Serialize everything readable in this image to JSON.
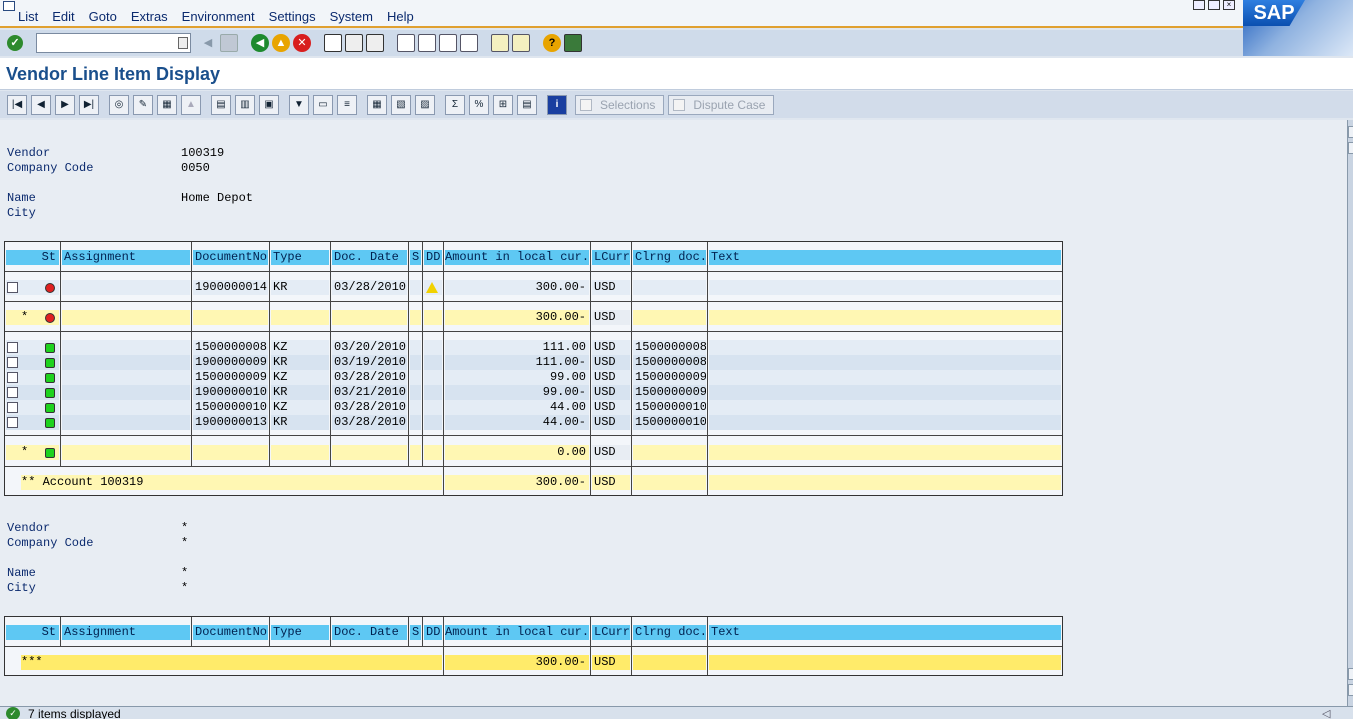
{
  "menu": [
    "List",
    "Edit",
    "Goto",
    "Extras",
    "Environment",
    "Settings",
    "System",
    "Help"
  ],
  "brand": "SAP",
  "title": "Vendor Line Item Display",
  "app_toolbar": {
    "selections_label": "Selections",
    "dispute_label": "Dispute Case"
  },
  "block1": {
    "vendor_label": "Vendor",
    "vendor_value": "100319",
    "company_label": "Company Code",
    "company_value": "0050",
    "name_label": "Name",
    "name_value": "Home Depot",
    "city_label": "City",
    "city_value": ""
  },
  "columns": {
    "st": "St",
    "assignment": "Assignment",
    "docno": "DocumentNo",
    "type": "Type",
    "docdate": "Doc. Date",
    "s": "S",
    "dd": "DD",
    "amount": "Amount in local cur.",
    "lcurr": "LCurr",
    "clrng": "Clrng doc.",
    "text": "Text"
  },
  "group1": {
    "items": [
      {
        "docno": "1900000014",
        "type": "KR",
        "date": "03/28/2010",
        "amount": "300.00-",
        "curr": "USD",
        "clrng": ""
      }
    ],
    "subtotal_marker": "*",
    "subtotal": "300.00-",
    "subtotal_curr": "USD"
  },
  "group2": {
    "items": [
      {
        "docno": "1500000008",
        "type": "KZ",
        "date": "03/20/2010",
        "amount": "111.00",
        "curr": "USD",
        "clrng": "1500000008"
      },
      {
        "docno": "1900000009",
        "type": "KR",
        "date": "03/19/2010",
        "amount": "111.00-",
        "curr": "USD",
        "clrng": "1500000008"
      },
      {
        "docno": "1500000009",
        "type": "KZ",
        "date": "03/28/2010",
        "amount": "99.00",
        "curr": "USD",
        "clrng": "1500000009"
      },
      {
        "docno": "1900000010",
        "type": "KR",
        "date": "03/21/2010",
        "amount": "99.00-",
        "curr": "USD",
        "clrng": "1500000009"
      },
      {
        "docno": "1500000010",
        "type": "KZ",
        "date": "03/28/2010",
        "amount": "44.00",
        "curr": "USD",
        "clrng": "1500000010"
      },
      {
        "docno": "1900000013",
        "type": "KR",
        "date": "03/28/2010",
        "amount": "44.00-",
        "curr": "USD",
        "clrng": "1500000010"
      }
    ],
    "subtotal_marker": "*",
    "subtotal": "0.00",
    "subtotal_curr": "USD"
  },
  "account_total": {
    "label": "** Account 100319",
    "amount": "300.00-",
    "curr": "USD"
  },
  "block2": {
    "vendor_label": "Vendor",
    "vendor_value": "*",
    "company_label": "Company Code",
    "company_value": "*",
    "name_label": "Name",
    "name_value": "*",
    "city_label": "City",
    "city_value": "*"
  },
  "grand_total": {
    "label": "***",
    "amount": "300.00-",
    "curr": "USD"
  },
  "status": {
    "message": "7 items displayed"
  },
  "colors": {
    "header_blue": "#5ec8f3",
    "subtotal_yellow": "#fff7b3",
    "total_yellow": "#ffeb6a",
    "title_blue": "#1a4f8c"
  }
}
